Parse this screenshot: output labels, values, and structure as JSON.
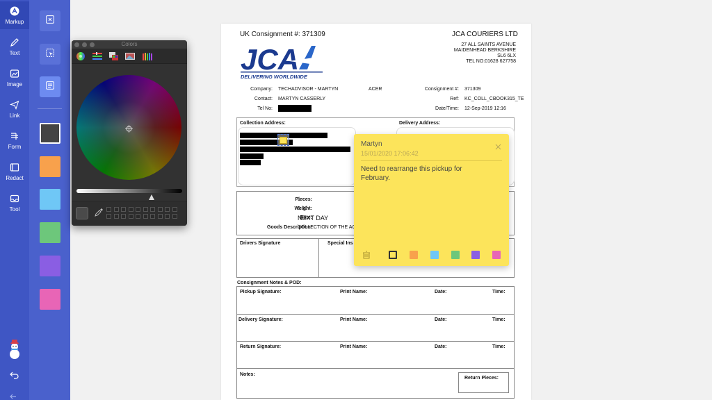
{
  "sidebar": {
    "items": [
      {
        "label": "Markup",
        "icon": "markup-icon"
      },
      {
        "label": "Text",
        "icon": "pencil-icon"
      },
      {
        "label": "Image",
        "icon": "image-icon"
      },
      {
        "label": "Link",
        "icon": "send-icon"
      },
      {
        "label": "Form",
        "icon": "form-icon"
      },
      {
        "label": "Redact",
        "icon": "redact-icon"
      },
      {
        "label": "Tool",
        "icon": "tool-icon"
      }
    ]
  },
  "swatches": [
    "#444444",
    "#f8a14c",
    "#6fc7f6",
    "#6dc77b",
    "#8a5ee3",
    "#e865b6"
  ],
  "colors_window": {
    "title": "Colors"
  },
  "document": {
    "consignment_header": "UK Consignment #: 371309",
    "company_name": "JCA COURIERS LTD",
    "address": [
      "27 ALL SAINTS AVENUE",
      "MAIDENHEAD BERKSHIRE",
      "SL6 6LX",
      "TEL NO:01628 627758"
    ],
    "logo_tagline": "DELIVERING WORLDWIDE",
    "logo_text": "JCA",
    "company_label": "Company:",
    "company_value": "TECHADVISOR - MARTYN",
    "company_extra": "ACER",
    "contact_label": "Contact:",
    "contact_value": "MARTYN CASSERLY",
    "tel_label": "Tel No:",
    "consignment_label": "Consignment #:",
    "consignment_value": "371309",
    "ref_label": "Ref:",
    "ref_value": "KC_COLL_CBOOK315_TE",
    "datetime_label": "Date/Time:",
    "datetime_value": "12-Sep-2019 12:16",
    "collection_address": "Collection Address:",
    "delivery_address": "Delivery Address:",
    "pieces_label": "Pieces:",
    "pieces_value": "1",
    "weight_label": "Weight:",
    "weight_value": "0.00",
    "rate_label": "Rate:",
    "rate_value": "NEXT DAY",
    "goods_label": "Goods Description:",
    "goods_value": "COLLECTION OF THE AC",
    "drivers_signature": "Drivers Signature",
    "special_ins": "Special Ins",
    "notes_pod": "Consignment Notes & POD:",
    "pickup_signature": "Pickup Signature:",
    "delivery_signature": "Delivery Signature:",
    "return_signature": "Return Signature:",
    "print_name": "Print Name:",
    "date": "Date:",
    "time": "Time:",
    "notes": "Notes:",
    "return_pieces": "Return Pieces:"
  },
  "sticky_note": {
    "author": "Martyn",
    "timestamp": "15/01/2020 17:06:42",
    "body": "Need to rearrange this pickup for February.",
    "colors": [
      "#fce45b",
      "#f8a14c",
      "#6fc7f6",
      "#6dc77b",
      "#8a5ee3",
      "#e865b6"
    ]
  }
}
